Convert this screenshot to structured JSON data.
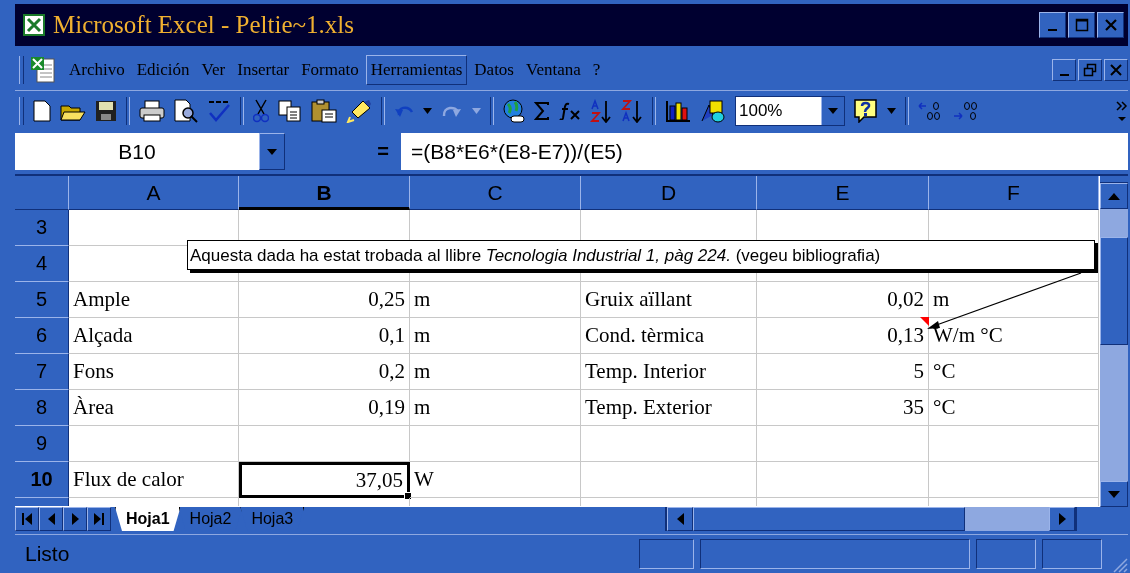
{
  "window": {
    "title": "Microsoft Excel - Peltie~1.xls"
  },
  "menu": [
    {
      "label": "Archivo",
      "highlighted": false
    },
    {
      "label": "Edición",
      "highlighted": false
    },
    {
      "label": "Ver",
      "highlighted": false
    },
    {
      "label": "Insertar",
      "highlighted": false
    },
    {
      "label": "Formato",
      "highlighted": false
    },
    {
      "label": "Herramientas",
      "highlighted": true
    },
    {
      "label": "Datos",
      "highlighted": false
    },
    {
      "label": "Ventana",
      "highlighted": false
    },
    {
      "label": "?",
      "highlighted": false
    }
  ],
  "toolbar": {
    "zoom": "100%"
  },
  "formula_bar": {
    "name_box": "B10",
    "equals": "=",
    "formula": "=(B8*E6*(E8-E7))/(E5)"
  },
  "columns": [
    {
      "label": "A",
      "selected": false
    },
    {
      "label": "B",
      "selected": true
    },
    {
      "label": "C",
      "selected": false
    },
    {
      "label": "D",
      "selected": false
    },
    {
      "label": "E",
      "selected": false
    },
    {
      "label": "F",
      "selected": false
    }
  ],
  "rows": [
    {
      "label": "3",
      "selected": false,
      "cells": [
        null,
        null,
        null,
        null,
        null,
        null
      ]
    },
    {
      "label": "4",
      "selected": false,
      "cells": [
        null,
        null,
        null,
        null,
        null,
        null
      ]
    },
    {
      "label": "5",
      "selected": false,
      "cells": [
        {
          "text": "Ample",
          "kind": "text",
          "selected": false
        },
        {
          "text": "0,25",
          "kind": "number",
          "selected": false
        },
        {
          "text": "m",
          "kind": "text",
          "selected": false
        },
        {
          "text": "Gruix aïllant",
          "kind": "text",
          "selected": false
        },
        {
          "text": "0,02",
          "kind": "number",
          "selected": false
        },
        {
          "text": "m",
          "kind": "text",
          "selected": false
        }
      ]
    },
    {
      "label": "6",
      "selected": false,
      "cells": [
        {
          "text": "Alçada",
          "kind": "text",
          "selected": false
        },
        {
          "text": "0,1",
          "kind": "number",
          "selected": false
        },
        {
          "text": "m",
          "kind": "text",
          "selected": false
        },
        {
          "text": "Cond. tèrmica",
          "kind": "text",
          "selected": false
        },
        {
          "text": "0,13",
          "kind": "number",
          "selected": false,
          "comment": true
        },
        {
          "text": "W/m °C",
          "kind": "text",
          "selected": false
        }
      ]
    },
    {
      "label": "7",
      "selected": false,
      "cells": [
        {
          "text": "Fons",
          "kind": "text",
          "selected": false
        },
        {
          "text": "0,2",
          "kind": "number",
          "selected": false
        },
        {
          "text": "m",
          "kind": "text",
          "selected": false
        },
        {
          "text": "Temp. Interior",
          "kind": "text",
          "selected": false
        },
        {
          "text": "5",
          "kind": "number",
          "selected": false
        },
        {
          "text": "°C",
          "kind": "text",
          "selected": false
        }
      ]
    },
    {
      "label": "8",
      "selected": false,
      "cells": [
        {
          "text": "Àrea",
          "kind": "text",
          "selected": false
        },
        {
          "text": "0,19",
          "kind": "number",
          "selected": false
        },
        {
          "text": "m",
          "kind": "text",
          "selected": false
        },
        {
          "text": "Temp. Exterior",
          "kind": "text",
          "selected": false
        },
        {
          "text": "35",
          "kind": "number",
          "selected": false
        },
        {
          "text": "°C",
          "kind": "text",
          "selected": false
        }
      ]
    },
    {
      "label": "9",
      "selected": false,
      "cells": [
        null,
        null,
        null,
        null,
        null,
        null
      ]
    },
    {
      "label": "10",
      "selected": true,
      "cells": [
        {
          "text": "Flux de calor",
          "kind": "text",
          "selected": false
        },
        {
          "text": "37,05",
          "kind": "number",
          "selected": true
        },
        {
          "text": "W",
          "kind": "text",
          "selected": false
        },
        null,
        null,
        null
      ]
    }
  ],
  "comment": {
    "text": "Aquesta dada ha estat trobada al llibre *Tecnologia Industrial 1, pàg 224.*  (vegeu bibliografia)"
  },
  "sheet_tabs": [
    {
      "label": "Hoja1",
      "selected": true
    },
    {
      "label": "Hoja2",
      "selected": false
    },
    {
      "label": "Hoja3",
      "selected": false
    }
  ],
  "status_bar": {
    "text": "Listo"
  }
}
